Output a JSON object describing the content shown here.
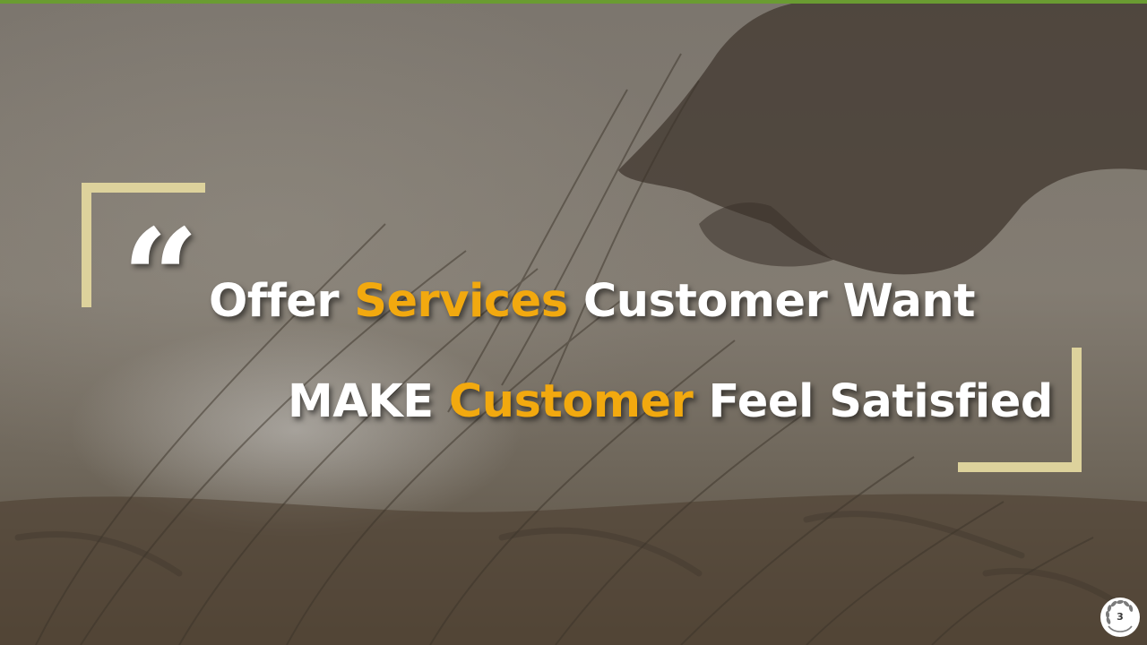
{
  "colors": {
    "top_bar": "#6a9c32",
    "accent": "#f2a90f",
    "bracket": "#ddd29c",
    "text": "#ffffff"
  },
  "quote": {
    "mark": "“"
  },
  "line1": {
    "part1": "Offer ",
    "accent": "Services",
    "part2": " Customer Want"
  },
  "line2": {
    "part1": "MAKE ",
    "accent": "Customer",
    "part2": " Feel Satisfied"
  },
  "page": {
    "number": "3",
    "icon": "wheat-wreath-icon"
  }
}
